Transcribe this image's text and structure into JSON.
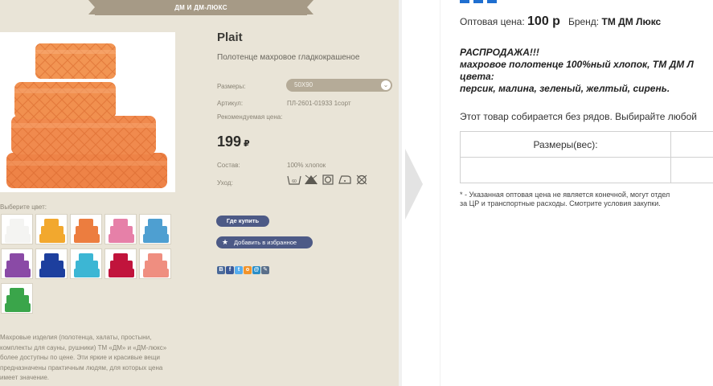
{
  "ribbon": {
    "label": "ДМ И ДМ-ЛЮКС"
  },
  "product": {
    "title": "Plait",
    "subtitle": "Полотенце махровое гладкокрашеное",
    "specs": {
      "size_label": "Размеры:",
      "size_value": "50X90",
      "article_label": "Артикул:",
      "article_value": "ПЛ-2601-01933 1сорт",
      "price_label": "Рекомендуемая цена:",
      "price_value": "199",
      "currency": "₽",
      "composition_label": "Состав:",
      "composition_value": "100% хлопок",
      "care_label": "Уход:"
    },
    "care_icons": [
      "wash-60-icon",
      "no-bleach-icon",
      "tumble-dry-icon",
      "iron-icon",
      "no-dry-clean-icon"
    ],
    "buttons": {
      "where_buy": "Где купить",
      "add_favorite": "Добавить в избранное"
    },
    "social_icons": [
      {
        "name": "vk-icon",
        "glyph": "В",
        "color": "#4b6a9a"
      },
      {
        "name": "facebook-icon",
        "glyph": "f",
        "color": "#3b5998"
      },
      {
        "name": "twitter-icon",
        "glyph": "t",
        "color": "#55acee"
      },
      {
        "name": "odnoklassniki-icon",
        "glyph": "о",
        "color": "#f2932a"
      },
      {
        "name": "mailru-icon",
        "glyph": "@",
        "color": "#2a8ec8"
      },
      {
        "name": "livejournal-icon",
        "glyph": "✎",
        "color": "#5a6f8a"
      }
    ]
  },
  "colors": {
    "label": "Выберите цвет:",
    "swatches": [
      {
        "name": "white",
        "hex": "#f4f4f2"
      },
      {
        "name": "yellow",
        "hex": "#f2a82e"
      },
      {
        "name": "orange",
        "hex": "#ec7d3f"
      },
      {
        "name": "pink",
        "hex": "#e680a8"
      },
      {
        "name": "light-blue",
        "hex": "#4e9fd1"
      },
      {
        "name": "purple",
        "hex": "#8a4aa6"
      },
      {
        "name": "blue",
        "hex": "#1d3f9e"
      },
      {
        "name": "turquoise",
        "hex": "#3cb6d4"
      },
      {
        "name": "crimson",
        "hex": "#c1143c"
      },
      {
        "name": "peach",
        "hex": "#ef8e80"
      },
      {
        "name": "green",
        "hex": "#3aa54a"
      }
    ]
  },
  "left_description": "Махровые изделия (полотенца, халаты, простыни, комплекты для сауны, рушники) ТМ «ДМ» и «ДМ-люкс» более доступны по цене. Эти яркие и красивые вещи предназначены практичным людям, для которых цена имеет значение.",
  "right": {
    "wholesale_label": "Оптовая цена:",
    "wholesale_price": "100 р",
    "brand_label": "Бренд:",
    "brand_value": "ТМ ДМ Люкс",
    "promo": [
      "РАСПРОДАЖА!!!",
      "махровое полотенце 100%ный хлопок, ТМ ДМ Л",
      "цвета:",
      "персик, малина, зеленый, желтый, сирень."
    ],
    "notice": "Этот товар собирается без рядов. Выбирайте любой",
    "table_header": "Размеры(вес):",
    "footnote": [
      "* - Указанная оптовая цена не является конечной, могут отдел",
      "за ЦР и транспортные расходы. Смотрите условия закупки."
    ]
  }
}
